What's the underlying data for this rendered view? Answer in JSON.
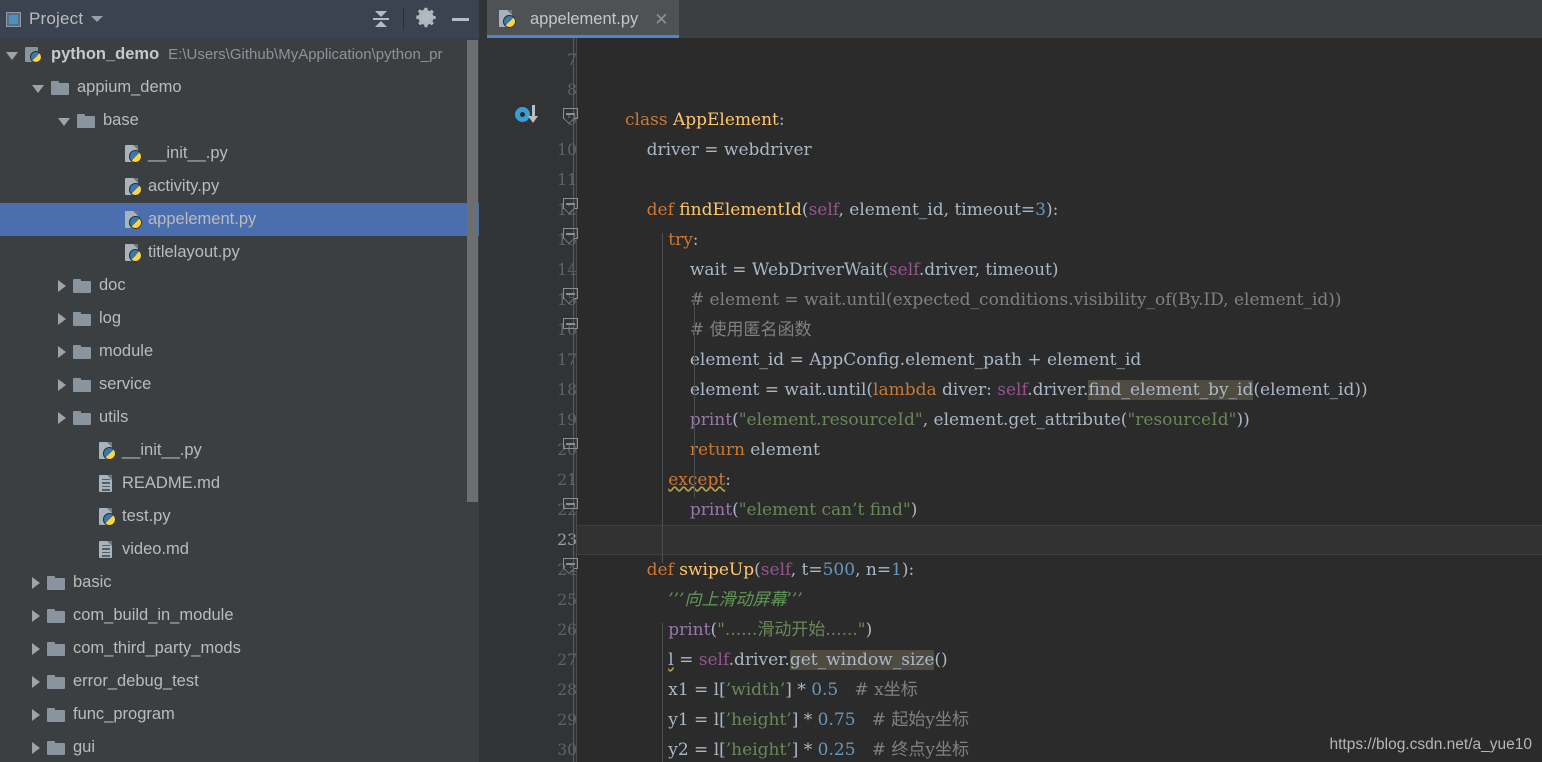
{
  "toolwindow": {
    "title": "Project",
    "icon": "project-icon",
    "dropdown_icon": "chevron-down-icon",
    "buttons": [
      {
        "name": "collapse-all-button",
        "icon": "collapse-all-icon",
        "label": "Collapse All"
      },
      {
        "name": "settings-button",
        "icon": "gear-icon",
        "label": "Settings"
      },
      {
        "name": "hide-button",
        "icon": "minus-icon",
        "label": "Hide"
      }
    ]
  },
  "tree": {
    "items": [
      {
        "label": "python_demo",
        "path": "E:\\Users\\Github\\MyApplication\\python_pr",
        "icon": "python-project-icon",
        "indent": 0,
        "state": "expanded",
        "bold": true,
        "selected": false
      },
      {
        "label": "appium_demo",
        "icon": "folder-icon",
        "indent": 1,
        "state": "expanded",
        "selected": false
      },
      {
        "label": "base",
        "icon": "folder-icon",
        "indent": 2,
        "state": "expanded",
        "selected": false
      },
      {
        "label": "__init__.py",
        "icon": "python-file-icon",
        "indent": 4,
        "state": "leaf",
        "selected": false
      },
      {
        "label": "activity.py",
        "icon": "python-file-icon",
        "indent": 4,
        "state": "leaf",
        "selected": false
      },
      {
        "label": "appelement.py",
        "icon": "python-file-icon",
        "indent": 4,
        "state": "leaf",
        "selected": true
      },
      {
        "label": "titlelayout.py",
        "icon": "python-file-icon",
        "indent": 4,
        "state": "leaf",
        "selected": false
      },
      {
        "label": "doc",
        "icon": "folder-icon",
        "indent": 2,
        "state": "collapsed",
        "selected": false
      },
      {
        "label": "log",
        "icon": "folder-icon",
        "indent": 2,
        "state": "collapsed",
        "selected": false
      },
      {
        "label": "module",
        "icon": "folder-icon",
        "indent": 2,
        "state": "collapsed",
        "selected": false
      },
      {
        "label": "service",
        "icon": "folder-icon",
        "indent": 2,
        "state": "collapsed",
        "selected": false
      },
      {
        "label": "utils",
        "icon": "folder-icon",
        "indent": 2,
        "state": "collapsed",
        "selected": false
      },
      {
        "label": "__init__.py",
        "icon": "python-file-icon",
        "indent": 3,
        "state": "leaf",
        "selected": false
      },
      {
        "label": "README.md",
        "icon": "markdown-file-icon",
        "indent": 3,
        "state": "leaf",
        "selected": false
      },
      {
        "label": "test.py",
        "icon": "python-file-icon",
        "indent": 3,
        "state": "leaf",
        "selected": false
      },
      {
        "label": "video.md",
        "icon": "markdown-file-icon",
        "indent": 3,
        "state": "leaf",
        "selected": false
      },
      {
        "label": "basic",
        "icon": "folder-icon",
        "indent": 1,
        "state": "collapsed",
        "selected": false
      },
      {
        "label": "com_build_in_module",
        "icon": "folder-icon",
        "indent": 1,
        "state": "collapsed",
        "selected": false
      },
      {
        "label": "com_third_party_mods",
        "icon": "folder-icon",
        "indent": 1,
        "state": "collapsed",
        "selected": false
      },
      {
        "label": "error_debug_test",
        "icon": "folder-icon",
        "indent": 1,
        "state": "collapsed",
        "selected": false
      },
      {
        "label": "func_program",
        "icon": "folder-icon",
        "indent": 1,
        "state": "collapsed",
        "selected": false
      },
      {
        "label": "gui",
        "icon": "folder-icon",
        "indent": 1,
        "state": "collapsed",
        "selected": false
      }
    ]
  },
  "editor": {
    "tab": {
      "label": "appelement.py",
      "icon": "python-file-icon",
      "close_icon": "close-icon",
      "active": true
    },
    "current_line": 23,
    "gutter_icon": "implemented-method-icon",
    "line_numbers": [
      7,
      8,
      9,
      10,
      11,
      12,
      13,
      14,
      15,
      16,
      17,
      18,
      19,
      20,
      21,
      22,
      23,
      24,
      25,
      26,
      27,
      28,
      29,
      30
    ],
    "fold_lines": [
      9,
      12,
      13,
      15,
      16,
      20,
      22,
      24
    ],
    "lines": [
      {
        "n": 7,
        "text": ""
      },
      {
        "n": 8,
        "text": ""
      },
      {
        "n": 9,
        "text": "class AppElement:"
      },
      {
        "n": 10,
        "text": "    driver = webdriver"
      },
      {
        "n": 11,
        "text": ""
      },
      {
        "n": 12,
        "text": "    def findElementId(self, element_id, timeout=3):"
      },
      {
        "n": 13,
        "text": "        try:"
      },
      {
        "n": 14,
        "text": "            wait = WebDriverWait(self.driver, timeout)"
      },
      {
        "n": 15,
        "text": "            # element = wait.until(expected_conditions.visibility_of(By.ID, element_id))"
      },
      {
        "n": 16,
        "text": "            # 使用匿名函数"
      },
      {
        "n": 17,
        "text": "            element_id = AppConfig.element_path + element_id"
      },
      {
        "n": 18,
        "text": "            element = wait.until(lambda diver: self.driver.find_element_by_id(element_id))"
      },
      {
        "n": 19,
        "text": "            print(\"element.resourceId\", element.get_attribute(\"resourceId\"))"
      },
      {
        "n": 20,
        "text": "            return element"
      },
      {
        "n": 21,
        "text": "        except:"
      },
      {
        "n": 22,
        "text": "            print(\"element can't find\")"
      },
      {
        "n": 23,
        "text": ""
      },
      {
        "n": 24,
        "text": "    def swipeUp(self, t=500, n=1):"
      },
      {
        "n": 25,
        "text": "        '''向上滑动屏幕'''"
      },
      {
        "n": 26,
        "text": "        print(\"......滑动开始......\")"
      },
      {
        "n": 27,
        "text": "        l = self.driver.get_window_size()"
      },
      {
        "n": 28,
        "text": "        x1 = l['width'] * 0.5   # x坐标"
      },
      {
        "n": 29,
        "text": "        y1 = l['height'] * 0.75   # 起始y坐标"
      },
      {
        "n": 30,
        "text": "        y2 = l['height'] * 0.25   # 终点y坐标"
      }
    ],
    "highlighted_identifiers": [
      "find_element_by_id",
      "get_window_size"
    ],
    "warning_tokens": [
      "except"
    ]
  },
  "watermark": {
    "text": "https://blog.csdn.net/a_yue10"
  },
  "colors": {
    "accent": "#4b6eaf",
    "tab_underline": "#4a88c7",
    "editor_bg": "#2b2b2b",
    "gutter_bg": "#313335",
    "panel_bg": "#3c3f41",
    "header_bg": "#3c4350",
    "keyword": "#cc7832",
    "function": "#ffc66d",
    "string": "#6a8759",
    "number": "#6897bb",
    "comment": "#808080",
    "docstring": "#629755",
    "self": "#94558d",
    "violet": "#9876aa",
    "identifier_highlight": "#4f4b41"
  }
}
